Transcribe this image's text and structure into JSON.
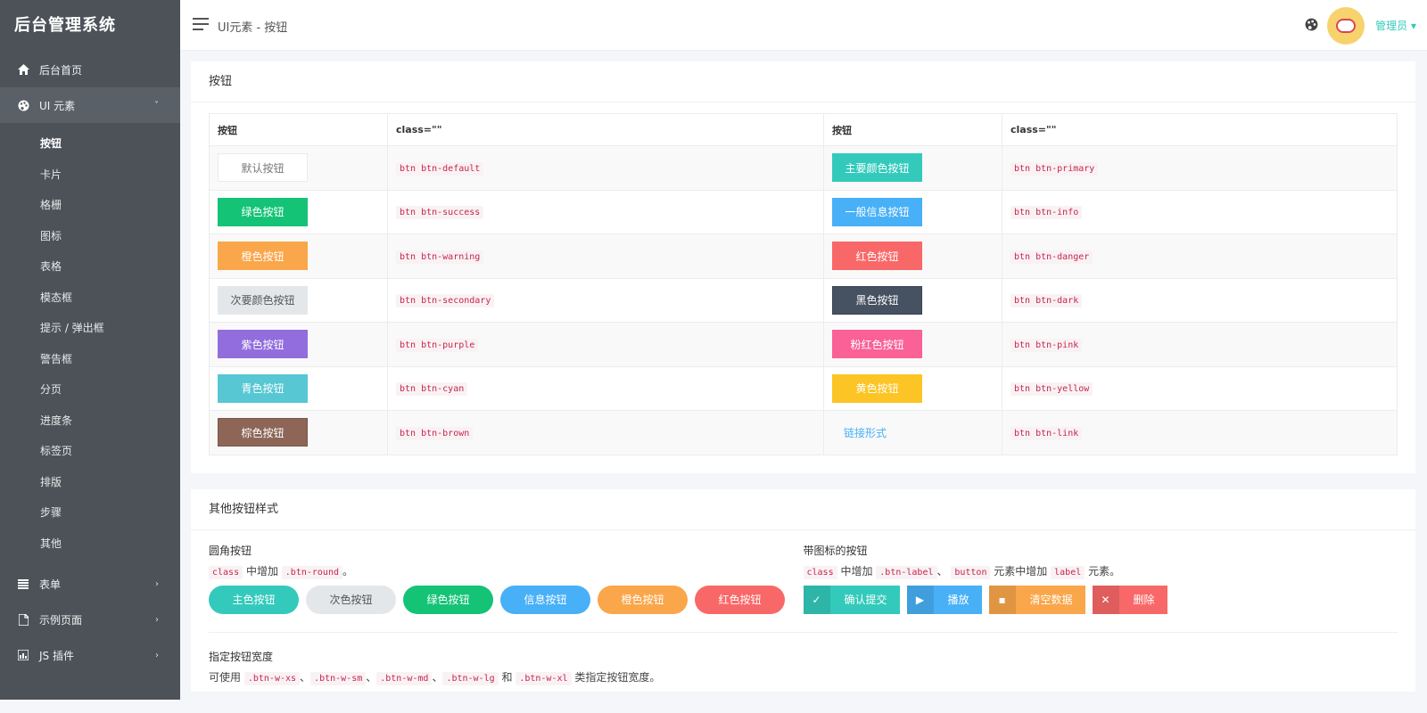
{
  "app": {
    "title": "后台管理系统"
  },
  "sidebar": {
    "items": [
      {
        "label": "后台首页",
        "icon": "home-icon"
      },
      {
        "label": "UI 元素",
        "icon": "palette-icon",
        "caret": "˅"
      }
    ],
    "submenu": [
      "按钮",
      "卡片",
      "格栅",
      "图标",
      "表格",
      "模态框",
      "提示 / 弹出框",
      "警告框",
      "分页",
      "进度条",
      "标签页",
      "排版",
      "步骤",
      "其他"
    ],
    "bottom_items": [
      {
        "label": "表单",
        "icon": "list-icon",
        "caret": "›"
      },
      {
        "label": "示例页面",
        "icon": "file-icon",
        "caret": "›"
      },
      {
        "label": "JS 插件",
        "icon": "plugin-icon",
        "caret": "›"
      }
    ]
  },
  "header": {
    "breadcrumb": "UI元素 - 按钮",
    "user": "管理员"
  },
  "buttons_card": {
    "title": "按钮",
    "headers": [
      "按钮",
      "class=\"\"",
      "按钮",
      "class=\"\""
    ],
    "rows": [
      {
        "l_label": "默认按钮",
        "l_class": "btn btn-default",
        "l_style": "default",
        "r_label": "主要颜色按钮",
        "r_class": "btn btn-primary",
        "r_style": "primary"
      },
      {
        "l_label": "绿色按钮",
        "l_class": "btn btn-success",
        "l_style": "success",
        "r_label": "一般信息按钮",
        "r_class": "btn btn-info",
        "r_style": "info"
      },
      {
        "l_label": "橙色按钮",
        "l_class": "btn btn-warning",
        "l_style": "warning",
        "r_label": "红色按钮",
        "r_class": "btn btn-danger",
        "r_style": "danger"
      },
      {
        "l_label": "次要颜色按钮",
        "l_class": "btn btn-secondary",
        "l_style": "secondary",
        "r_label": "黑色按钮",
        "r_class": "btn btn-dark",
        "r_style": "dark"
      },
      {
        "l_label": "紫色按钮",
        "l_class": "btn btn-purple",
        "l_style": "purple",
        "r_label": "粉红色按钮",
        "r_class": "btn btn-pink",
        "r_style": "pink"
      },
      {
        "l_label": "青色按钮",
        "l_class": "btn btn-cyan",
        "l_style": "cyan",
        "r_label": "黄色按钮",
        "r_class": "btn btn-yellow",
        "r_style": "yellow"
      },
      {
        "l_label": "棕色按钮",
        "l_class": "btn btn-brown",
        "l_style": "brown",
        "r_label": "链接形式",
        "r_class": "btn btn-link",
        "r_style": "link"
      }
    ]
  },
  "other_card": {
    "title": "其他按钮样式",
    "round": {
      "title": "圆角按钮",
      "desc_code1": "class",
      "desc_text1": "中增加",
      "desc_code2": ".btn-round",
      "desc_text2": "。",
      "buttons": [
        {
          "label": "主色按钮",
          "color": "#33cabb",
          "text_color": "#ffffff"
        },
        {
          "label": "次色按钮",
          "color": "#e4e7ea",
          "text_color": "#555555"
        },
        {
          "label": "绿色按钮",
          "color": "#15c377",
          "text_color": "#ffffff"
        },
        {
          "label": "信息按钮",
          "color": "#48b0f7",
          "text_color": "#ffffff"
        },
        {
          "label": "橙色按钮",
          "color": "#faa64b",
          "text_color": "#ffffff"
        },
        {
          "label": "红色按钮",
          "color": "#f96868",
          "text_color": "#ffffff"
        }
      ]
    },
    "icon_btns": {
      "title": "带图标的按钮",
      "desc_code1": "class",
      "desc_text1": "中增加",
      "desc_code2": ".btn-label",
      "desc_text2": "、",
      "desc_code3": "button",
      "desc_text3": "元素中增加",
      "desc_code4": "label",
      "desc_text4": "元素。",
      "buttons": [
        {
          "label": "确认提交",
          "icon": "check-circle-icon",
          "glyph": "✓",
          "color": "#33cabb"
        },
        {
          "label": "播放",
          "icon": "play-icon",
          "glyph": "▶",
          "color": "#48b0f7"
        },
        {
          "label": "清空数据",
          "icon": "trash-icon",
          "glyph": "▪",
          "color": "#faa64b"
        },
        {
          "label": "删除",
          "icon": "close-icon",
          "glyph": "✕",
          "color": "#f96868"
        }
      ]
    },
    "width": {
      "title": "指定按钮宽度",
      "desc_prefix": "可使用",
      "codes": [
        ".btn-w-xs",
        ".btn-w-sm",
        ".btn-w-md",
        ".btn-w-lg",
        ".btn-w-xl"
      ],
      "sep": "、",
      "and": "和",
      "suffix": "类指定按钮宽度。"
    }
  }
}
